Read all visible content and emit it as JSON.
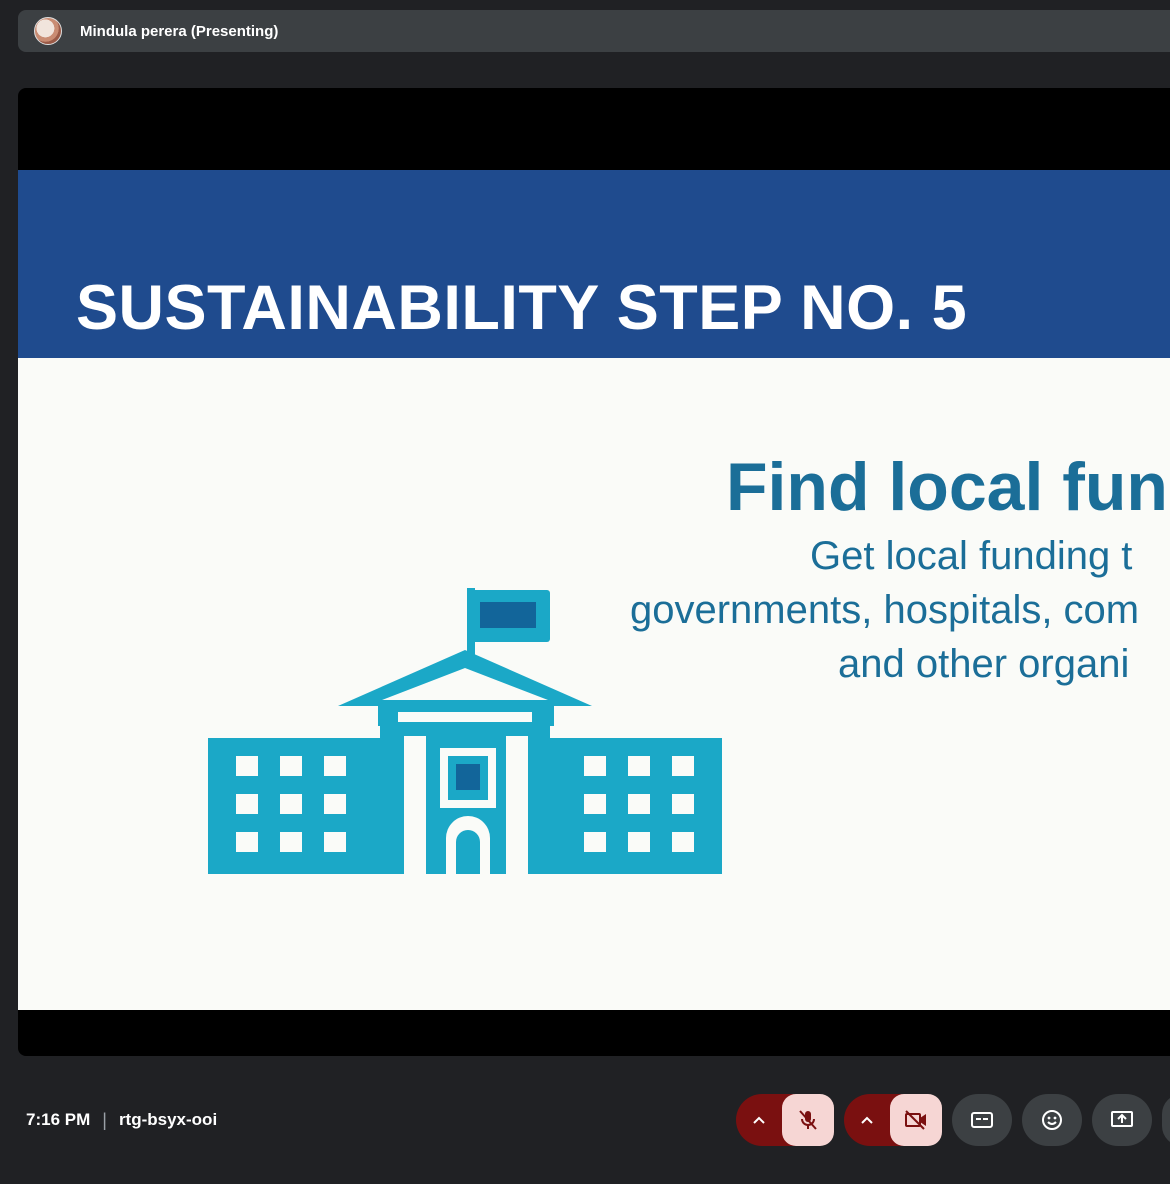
{
  "presenter": {
    "name": "Mindula perera (Presenting)"
  },
  "slide": {
    "title": "SUSTAINABILITY STEP NO. 5",
    "heading": "Find local fun",
    "body": [
      "Get local funding t",
      "governments, hospitals, com",
      "and other organi"
    ]
  },
  "footer": {
    "time": "7:16 PM",
    "separator": "|",
    "meeting_code": "rtg-bsyx-ooi"
  },
  "controls": {
    "mic": {
      "icon": "mic-off-icon",
      "state": "off"
    },
    "camera": {
      "icon": "camera-off-icon",
      "state": "off"
    },
    "captions": {
      "icon": "captions-icon"
    },
    "reactions": {
      "icon": "emoji-icon"
    },
    "present": {
      "icon": "present-screen-icon"
    }
  },
  "colors": {
    "app_bg": "#202124",
    "bar_bg": "#3c4043",
    "slide_header": "#1f4b8e",
    "slide_text": "#1b6e98",
    "building": "#1ba8c7",
    "danger": "#7a1010",
    "danger_light": "#f6d6d4"
  }
}
